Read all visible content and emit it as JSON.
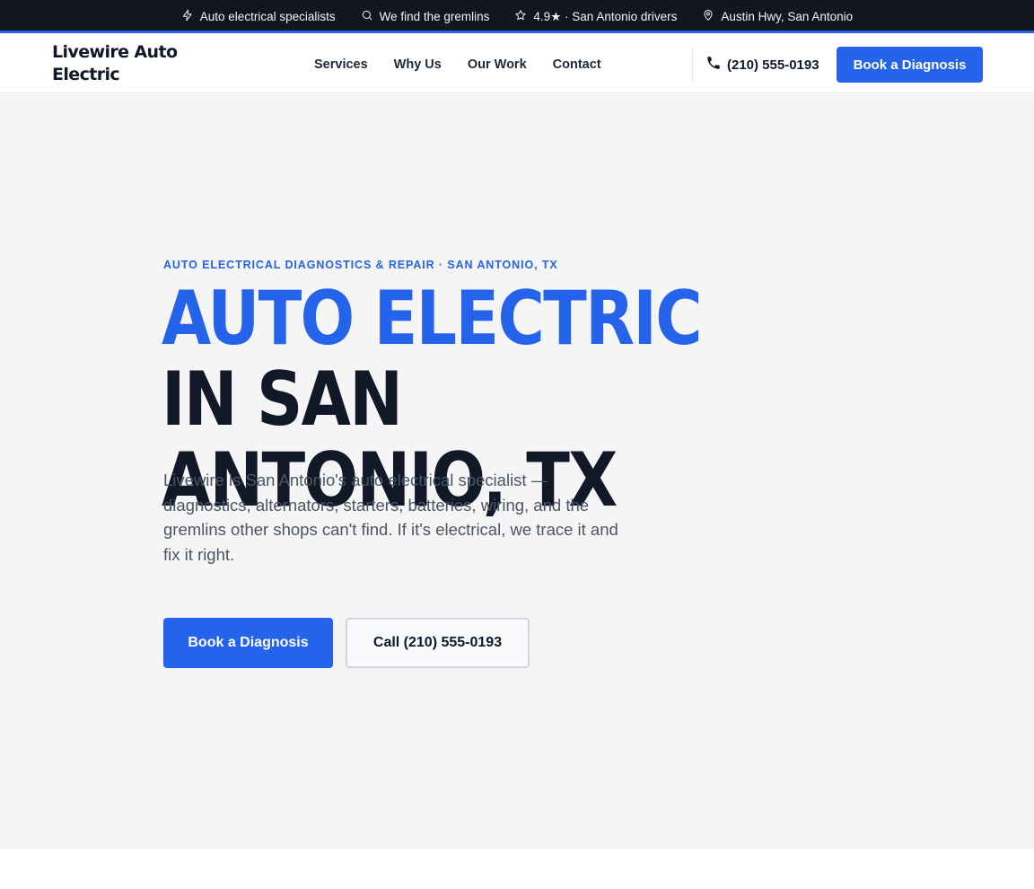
{
  "topbar": {
    "items": [
      {
        "icon": "bolt-icon",
        "text": "Auto electrical specialists"
      },
      {
        "icon": "search-icon",
        "text": "We find the gremlins"
      },
      {
        "icon": "star-icon",
        "text": "4.9★ · San Antonio drivers"
      },
      {
        "icon": "map-pin-icon",
        "text": "Austin Hwy, San Antonio"
      }
    ]
  },
  "header": {
    "logo": "Livewire Auto Electric",
    "nav": [
      "Services",
      "Why Us",
      "Our Work",
      "Contact"
    ],
    "phone": "(210) 555-0193",
    "cta": "Book a Diagnosis"
  },
  "hero": {
    "eyebrow": "AUTO ELECTRICAL DIAGNOSTICS & REPAIR · SAN ANTONIO, TX",
    "headline_accent": "AUTO ELECTRIC",
    "headline_rest": " IN SAN ANTONIO, TX",
    "lede": "Livewire is San Antonio's auto electrical specialist — diagnostics, alternators, starters, batteries, wiring, and the gremlins other shops can't find. If it's electrical, we trace it and fix it right.",
    "primary_cta": "Book a Diagnosis",
    "secondary_cta": "Call (210) 555-0193"
  },
  "colors": {
    "accent": "#2563eb",
    "topbar_bg": "#12161f",
    "hero_bg": "#f5f5f6",
    "text_dark": "#111827",
    "text_muted": "#4b5563"
  }
}
